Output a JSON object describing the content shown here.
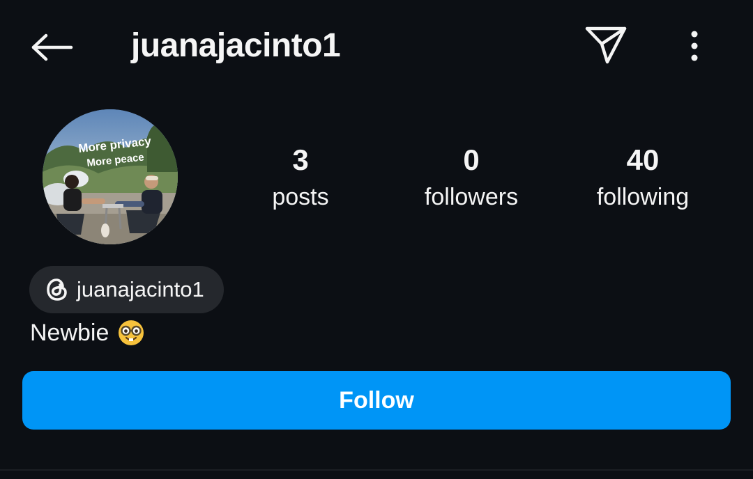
{
  "header": {
    "username": "juanajacinto1",
    "back_icon": "arrow-left-icon",
    "send_icon": "paper-plane-icon",
    "more_icon": "vertical-dots-icon"
  },
  "profile": {
    "avatar_caption_line1": "More privacy",
    "avatar_caption_line2": "More peace",
    "stats": [
      {
        "value": "3",
        "label": "posts"
      },
      {
        "value": "0",
        "label": "followers"
      },
      {
        "value": "40",
        "label": "following"
      }
    ],
    "threads_handle": "juanajacinto1",
    "threads_icon": "threads-logo-icon",
    "bio": "Newbie",
    "bio_emoji": "nerd-face-emoji"
  },
  "actions": {
    "follow_label": "Follow"
  },
  "colors": {
    "background": "#0c0f14",
    "follow_button": "#0095f6",
    "chip_background": "#25282d",
    "text": "#f5f5f5"
  }
}
